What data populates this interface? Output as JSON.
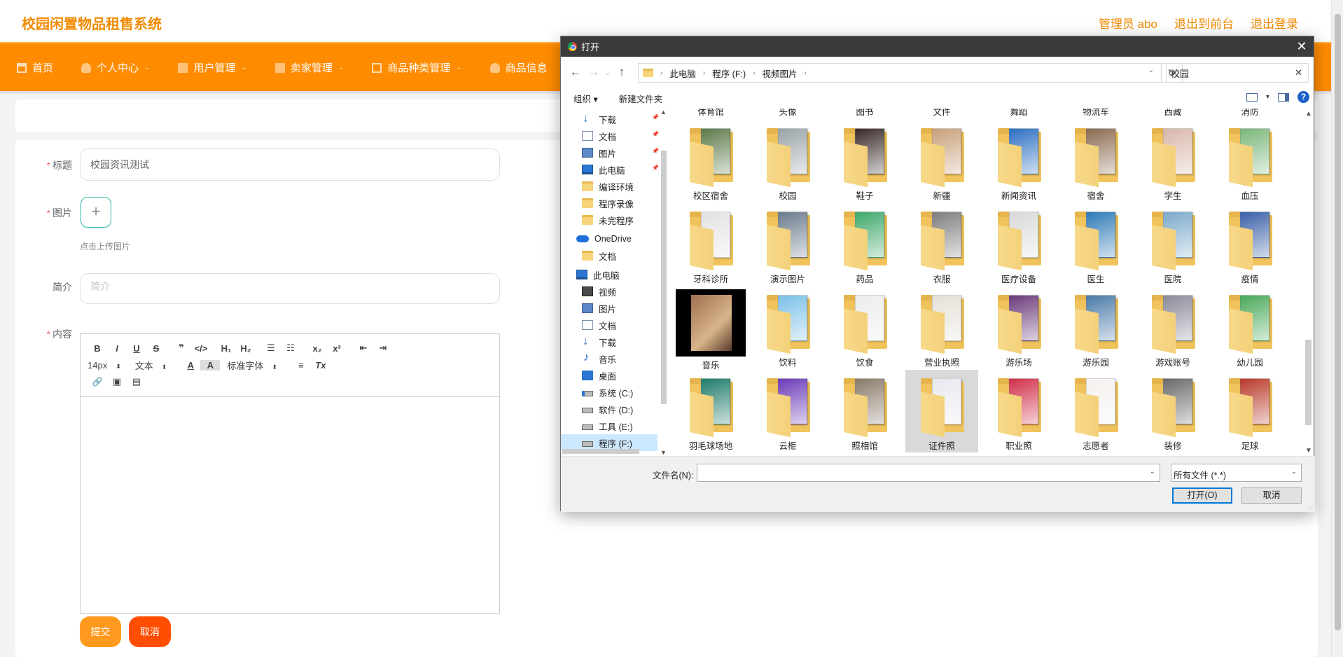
{
  "app": {
    "title": "校园闲置物品租售系统",
    "header_links": [
      "管理员 abo",
      "退出到前台",
      "退出登录"
    ],
    "nav": [
      {
        "label": "首页",
        "icon": "home-icon"
      },
      {
        "label": "个人中心",
        "icon": "user-icon",
        "caret": "⌄"
      },
      {
        "label": "用户管理",
        "icon": "grid-icon",
        "caret": "⌄"
      },
      {
        "label": "卖家管理",
        "icon": "grid-icon",
        "caret": "⌄"
      },
      {
        "label": "商品种类管理",
        "icon": "mail-icon",
        "caret": "⌄"
      },
      {
        "label": "商品信息",
        "icon": "user-icon"
      }
    ]
  },
  "form": {
    "title_label": "标题",
    "title_value": "校园资讯测试",
    "image_label": "图片",
    "upload_plus": "+",
    "upload_tip": "点击上传图片",
    "intro_label": "简介",
    "intro_placeholder": "简介",
    "content_label": "内容",
    "required_mark": "*",
    "submit": "提交",
    "cancel": "取消"
  },
  "editor": {
    "row1": [
      "B",
      "I",
      "U",
      "S",
      "❞",
      "</>",
      "H₁",
      "H₂",
      "☰",
      "☷",
      "x₂",
      "x²",
      "⇤",
      "⇥"
    ],
    "size_select": "14px",
    "text_select": "文本",
    "font_color": "A",
    "bg_color": "A",
    "font_select": "标准字体",
    "align": "≡",
    "clear_format": "Tx",
    "row3": [
      "🔗",
      "▣",
      "▤"
    ]
  },
  "dialog": {
    "title": "打开",
    "close": "✕",
    "back": "←",
    "forward": "→",
    "recent": "⌄",
    "up": "↑",
    "breadcrumb": [
      "此电脑",
      "程序 (F:)",
      "视频图片"
    ],
    "breadcrumb_sep": "›",
    "refresh": "↻",
    "search_value": "校园",
    "search_clear": "✕",
    "organize": "组织 ▾",
    "new_folder": "新建文件夹",
    "view_caret": "▾",
    "help": "?",
    "nav_items": [
      {
        "label": "下载",
        "icon": "ni-down",
        "pinned": true
      },
      {
        "label": "文档",
        "icon": "ni-doc",
        "pinned": true
      },
      {
        "label": "图片",
        "icon": "ni-pic",
        "pinned": true
      },
      {
        "label": "此电脑",
        "icon": "ni-pc",
        "pinned": true
      },
      {
        "label": "编译环境",
        "icon": "ni-folder"
      },
      {
        "label": "程序录像",
        "icon": "ni-folder"
      },
      {
        "label": "未完程序",
        "icon": "ni-folder"
      },
      {
        "label": "OneDrive",
        "icon": "ni-cloud",
        "section": true
      },
      {
        "label": "文档",
        "icon": "ni-folder"
      },
      {
        "label": "此电脑",
        "icon": "ni-pc",
        "section": true
      },
      {
        "label": "视频",
        "icon": "ni-video"
      },
      {
        "label": "图片",
        "icon": "ni-pic"
      },
      {
        "label": "文档",
        "icon": "ni-doc"
      },
      {
        "label": "下载",
        "icon": "ni-down"
      },
      {
        "label": "音乐",
        "icon": "ni-music"
      },
      {
        "label": "桌面",
        "icon": "ni-desk"
      },
      {
        "label": "系统 (C:)",
        "icon": "ni-sys"
      },
      {
        "label": "软件 (D:)",
        "icon": "ni-drive"
      },
      {
        "label": "工具 (E:)",
        "icon": "ni-drive"
      },
      {
        "label": "程序 (F:)",
        "icon": "ni-drive",
        "selected": true
      }
    ],
    "cut_row": [
      "体育馆",
      "头像",
      "图书",
      "文件",
      "舞蹈",
      "物流车",
      "西藏",
      "消防"
    ],
    "files": [
      {
        "name": "校区宿舍",
        "color": "#5d7a4a"
      },
      {
        "name": "校园",
        "color": "#9aa3a8"
      },
      {
        "name": "鞋子",
        "color": "#3a2a2a"
      },
      {
        "name": "新疆",
        "color": "#c7a07a"
      },
      {
        "name": "新闻资讯",
        "color": "#2c6fc2"
      },
      {
        "name": "宿舍",
        "color": "#8a6a50"
      },
      {
        "name": "学生",
        "color": "#d7b6a8"
      },
      {
        "name": "血压",
        "color": "#7bb77b"
      },
      {
        "name": "牙科诊所",
        "color": "#e2e2e2"
      },
      {
        "name": "演示图片",
        "color": "#6a7a8c"
      },
      {
        "name": "药品",
        "color": "#3ea86a"
      },
      {
        "name": "衣服",
        "color": "#7d7d7d"
      },
      {
        "name": "医疗设备",
        "color": "#d9d9d9"
      },
      {
        "name": "医生",
        "color": "#2f7ab8"
      },
      {
        "name": "医院",
        "color": "#7aa9c9"
      },
      {
        "name": "疫情",
        "color": "#3a5fa8"
      },
      {
        "name": "音乐",
        "color": "#a07050",
        "dark": true
      },
      {
        "name": "饮料",
        "color": "#7bc0e8"
      },
      {
        "name": "饮食",
        "color": "#ececec"
      },
      {
        "name": "营业执照",
        "color": "#e5e0d8"
      },
      {
        "name": "游乐场",
        "color": "#6a3a7a"
      },
      {
        "name": "游乐园",
        "color": "#4a7aa8"
      },
      {
        "name": "游戏账号",
        "color": "#8a8a9a"
      },
      {
        "name": "幼儿园",
        "color": "#4aa85a"
      },
      {
        "name": "羽毛球场地",
        "color": "#1d7a6a"
      },
      {
        "name": "云柜",
        "color": "#6a3ab8"
      },
      {
        "name": "照相馆",
        "color": "#8a7a6a"
      },
      {
        "name": "证件照",
        "color": "#e8e8f0",
        "selected": true
      },
      {
        "name": "职业照",
        "color": "#d0304a"
      },
      {
        "name": "志愿者",
        "color": "#f4f0ee"
      },
      {
        "name": "装修",
        "color": "#6a6a6a"
      },
      {
        "name": "足球",
        "color": "#b83a2a"
      }
    ],
    "filename_label": "文件名(N):",
    "filename_value": "",
    "filetype": "所有文件 (*.*)",
    "open_button": "打开(O)",
    "cancel_button": "取消"
  }
}
